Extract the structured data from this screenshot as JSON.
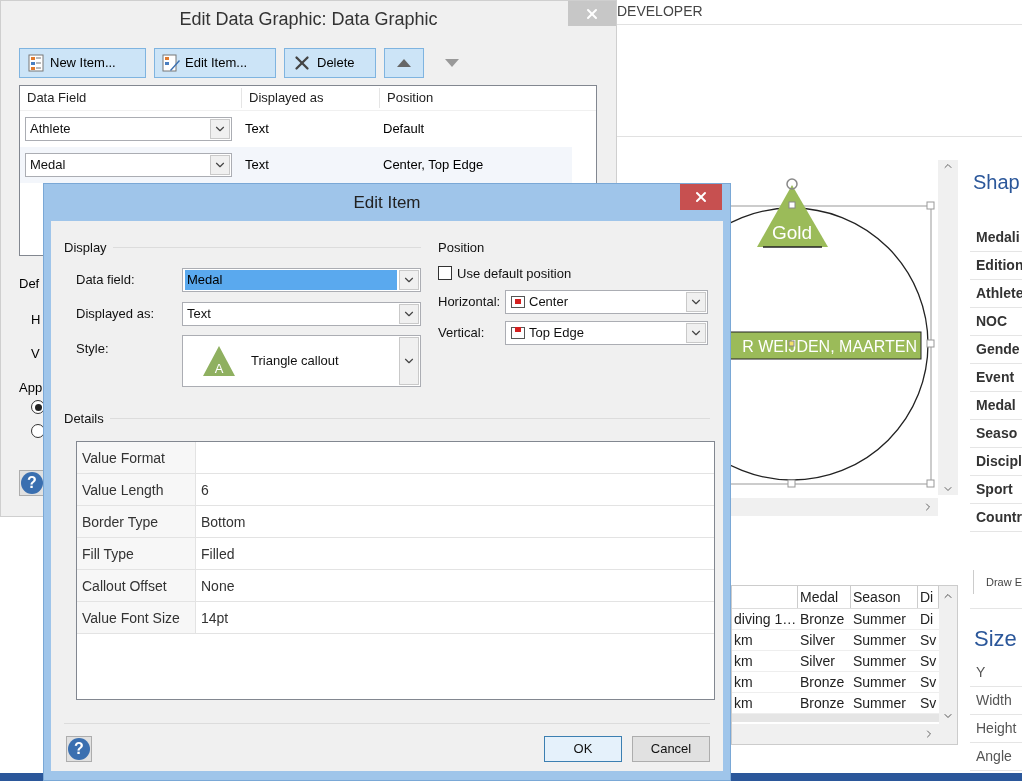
{
  "app": {
    "ribbon_tab": "DEVELOPER",
    "canvas": {
      "callout_text": "Gold",
      "label_text": "R WEIJDEN, MAARTEN"
    },
    "shape_data": {
      "title": "Shap",
      "fields": [
        "Medali",
        "Edition",
        "Athlete",
        "NOC",
        "Gende",
        "Event",
        "Medal",
        "Seaso",
        "Discipl",
        "Sport",
        "Countr"
      ]
    },
    "draw_link": "Draw E",
    "size": {
      "title": "Size",
      "fields": [
        "Y",
        "Width",
        "Height",
        "Angle"
      ]
    },
    "table": {
      "columns": [
        "",
        "Medal",
        "Season",
        "Di"
      ],
      "rows": [
        {
          "cells": [
            "diving 1…",
            "Bronze",
            "Summer",
            "Di"
          ]
        },
        {
          "cells": [
            "km",
            "Silver",
            "Summer",
            "Sv"
          ]
        },
        {
          "cells": [
            "km",
            "Silver",
            "Summer",
            "Sv"
          ]
        },
        {
          "cells": [
            "km",
            "Bronze",
            "Summer",
            "Sv"
          ]
        },
        {
          "cells": [
            "km",
            "Bronze",
            "Summer",
            "Sv"
          ]
        }
      ]
    }
  },
  "data_graphic_dialog": {
    "title": "Edit Data Graphic: Data Graphic",
    "toolbar": [
      {
        "label": "New Item...",
        "kind": "new",
        "disabled": false
      },
      {
        "label": "Edit Item...",
        "kind": "edit",
        "disabled": false
      },
      {
        "label": "Delete",
        "kind": "delete",
        "disabled": false
      },
      {
        "kind": "up",
        "disabled": false
      },
      {
        "kind": "down",
        "disabled": true
      }
    ],
    "columns": [
      "Data Field",
      "Displayed as",
      "Position"
    ],
    "rows": [
      {
        "field": "Athlete",
        "displayed_as": "Text",
        "position": "Default",
        "selected": false
      },
      {
        "field": "Medal",
        "displayed_as": "Text",
        "position": "Center, Top Edge",
        "selected": true
      }
    ],
    "cut_labels": [
      "Def",
      "H",
      "V",
      "App"
    ],
    "radios": [
      {
        "selected": true
      },
      {
        "selected": false
      }
    ],
    "help": "?"
  },
  "edit_item_dialog": {
    "title": "Edit Item",
    "display": {
      "heading": "Display",
      "fields": [
        {
          "label": "Data field:",
          "value": "Medal",
          "highlighted": true
        },
        {
          "label": "Displayed as:",
          "value": "Text",
          "highlighted": false
        }
      ],
      "style": {
        "label": "Style:",
        "icon_letter": "A",
        "value": "Triangle callout"
      }
    },
    "position": {
      "heading": "Position",
      "use_default": {
        "label": "Use default position",
        "checked": false
      },
      "fields": [
        {
          "label": "Horizontal:",
          "value": "Center"
        },
        {
          "label": "Vertical:",
          "value": "Top Edge"
        }
      ]
    },
    "details": {
      "heading": "Details",
      "rows": [
        {
          "name": "Value Format"
        },
        {
          "name": "Value Length",
          "value": "6"
        },
        {
          "name": "Border Type",
          "value": "Bottom"
        },
        {
          "name": "Fill Type",
          "value": "Filled"
        },
        {
          "name": "Callout Offset",
          "value": "None"
        },
        {
          "name": "Value Font Size",
          "value": "14pt"
        }
      ]
    },
    "help": "?",
    "buttons": [
      {
        "label": "OK",
        "default": true
      },
      {
        "label": "Cancel",
        "default": false
      }
    ]
  }
}
